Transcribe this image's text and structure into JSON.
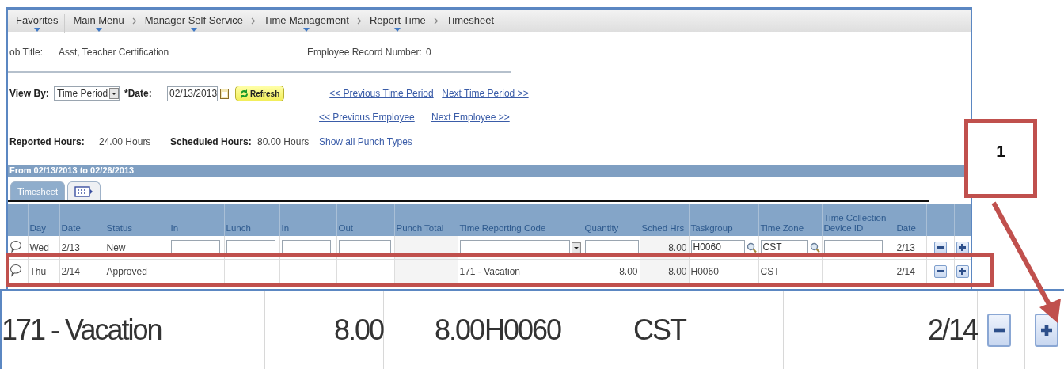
{
  "breadcrumb": [
    {
      "label": "Favorites",
      "menu": true
    },
    {
      "label": "Main Menu",
      "menu": true
    },
    {
      "label": "Manager Self Service",
      "menu": true
    },
    {
      "label": "Time Management",
      "menu": true
    },
    {
      "label": "Report Time",
      "menu": true
    },
    {
      "label": "Timesheet",
      "menu": false
    }
  ],
  "header": {
    "job_title_label": "ob Title:",
    "job_title": "Asst, Teacher Certification",
    "record_label": "Employee Record Number:",
    "record": "0"
  },
  "view_by": {
    "label": "View By:",
    "value": "Time Period"
  },
  "date": {
    "label": "*Date:",
    "value": "02/13/2013"
  },
  "refresh": "Refresh",
  "links": [
    {
      "label": "<< Previous Time Period"
    },
    {
      "label": "Next Time Period >>"
    },
    {
      "label": "<< Previous Employee"
    },
    {
      "label": "Next Employee >>"
    }
  ],
  "summary": [
    {
      "label": "Reported Hours:",
      "value": "24.00 Hours"
    },
    {
      "label": "Scheduled Hours:",
      "value": "80.00 Hours"
    }
  ],
  "punch_link": "Show all Punch Types",
  "period_title": "From 02/13/2013 to 02/26/2013",
  "tabs": [
    {
      "kind": "text",
      "label": "Timesheet",
      "selected": true
    },
    {
      "kind": "icon",
      "selected": false
    }
  ],
  "table": {
    "columns": [
      "Day",
      "Date",
      "Status",
      "In",
      "Lunch",
      "In",
      "Out",
      "Punch Total",
      "Time Reporting Code",
      "Quantity",
      "Sched Hrs",
      "Taskgroup",
      "Time Zone",
      "Time Collection Device ID",
      "Date"
    ],
    "rows": [
      {
        "editable": true,
        "highlighted": false,
        "day": "Wed",
        "date": "2/13",
        "status": "New",
        "sched_hrs": "8.00",
        "taskgroup": "H0060",
        "time_zone": "CST",
        "date_2": "2/13"
      },
      {
        "editable": false,
        "highlighted": true,
        "day": "Thu",
        "date": "2/14",
        "status": "Approved",
        "trc": "171 - Vacation",
        "quantity": "8.00",
        "sched_hrs": "8.00",
        "taskgroup": "H0060",
        "time_zone": "CST",
        "date_2": "2/14"
      }
    ]
  },
  "callout": {
    "label": "1"
  },
  "zoom_strip": {
    "trc": "171 - Vacation",
    "quantity": "8.00",
    "sched_hrs": "8.00",
    "taskgroup": "H0060",
    "time_zone": "CST",
    "date": "2/14"
  }
}
